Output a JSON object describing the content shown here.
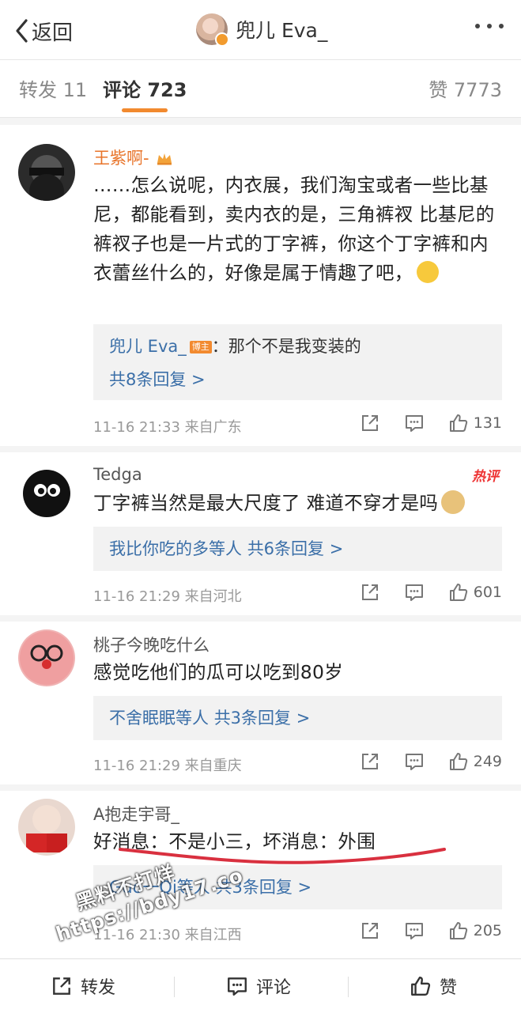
{
  "header": {
    "back_label": "返回",
    "title": "兜儿 Eva_"
  },
  "tabs": {
    "repost": "转发 11",
    "comments": "评论 723",
    "likes": "赞 7773"
  },
  "comments": [
    {
      "user": "王紫啊-",
      "text": "……怎么说呢，内衣展，我们淘宝或者一些比基尼，都能看到，卖内衣的是，三角裤衩 比基尼的裤衩子也是一片式的丁字裤，你这个丁字裤和内衣蕾丝什么的，好像是属于情趣了吧，",
      "reply_author": "兜儿 Eva_",
      "reply_author_tag": "博主",
      "reply_text": "：那个不是我变装的",
      "reply_more": "共8条回复 >",
      "time": "11-16 21:33",
      "location": "来自广东",
      "likes": "131"
    },
    {
      "user": "Tedga",
      "hot_badge": "热评",
      "text": "丁字裤当然是最大尺度了  难道不穿才是吗",
      "reply_line": "我比你吃的多等人",
      "reply_more": "共6条回复 >",
      "time": "11-16 21:29",
      "location": "来自河北",
      "likes": "601"
    },
    {
      "user": "桃子今晚吃什么",
      "text": "感觉吃他们的瓜可以吃到80岁",
      "reply_line": "不舍眠眠等人",
      "reply_more": "共3条回复 >",
      "time": "11-16 21:29",
      "location": "来自重庆",
      "likes": "249"
    },
    {
      "user": "A抱走宇哥_",
      "text": "好消息：不是小三，坏消息：外围",
      "reply_line": "Guo一Qi等人",
      "reply_more": "共3条回复 >",
      "time": "11-16 21:30",
      "location": "来自江西",
      "likes": "205"
    }
  ],
  "bottom_bar": {
    "repost": "转发",
    "comment": "评论",
    "like": "赞"
  },
  "watermark": {
    "line1": "黑料不打烊",
    "line2": "https://bdy17.co"
  },
  "colors": {
    "accent": "#f28a2f",
    "link": "#3b6fa8",
    "vip_name": "#e8742a",
    "hot": "#ee3333"
  }
}
